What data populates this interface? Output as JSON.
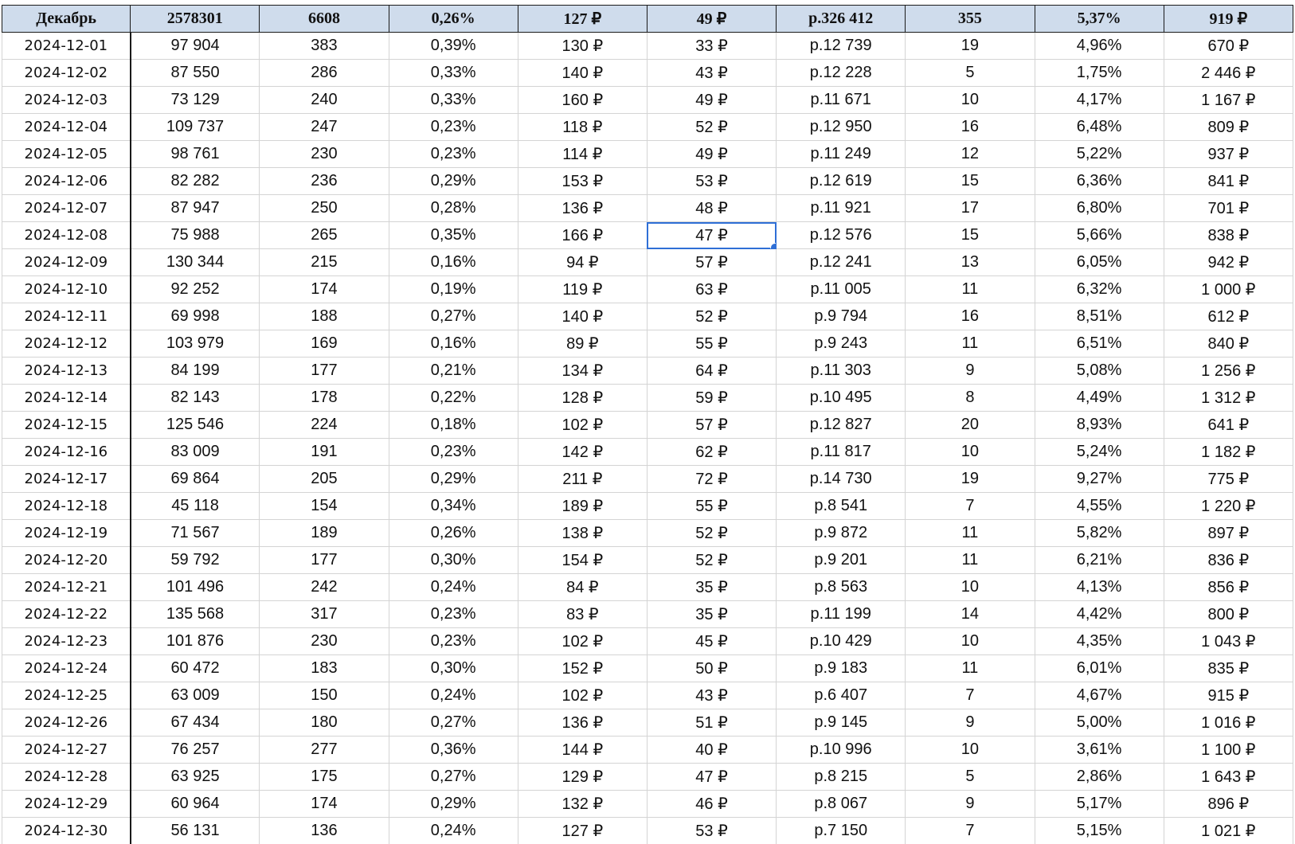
{
  "header": [
    "Декабрь",
    "2578301",
    "6608",
    "0,26%",
    "127 ₽",
    "49 ₽",
    "р.326 412",
    "355",
    "5,37%",
    "919 ₽"
  ],
  "rows": [
    [
      "2024-12-01",
      "97 904",
      "383",
      "0,39%",
      "130 ₽",
      "33 ₽",
      "р.12 739",
      "19",
      "4,96%",
      "670 ₽"
    ],
    [
      "2024-12-02",
      "87 550",
      "286",
      "0,33%",
      "140 ₽",
      "43 ₽",
      "р.12 228",
      "5",
      "1,75%",
      "2 446 ₽"
    ],
    [
      "2024-12-03",
      "73 129",
      "240",
      "0,33%",
      "160 ₽",
      "49 ₽",
      "р.11 671",
      "10",
      "4,17%",
      "1 167 ₽"
    ],
    [
      "2024-12-04",
      "109 737",
      "247",
      "0,23%",
      "118 ₽",
      "52 ₽",
      "р.12 950",
      "16",
      "6,48%",
      "809 ₽"
    ],
    [
      "2024-12-05",
      "98 761",
      "230",
      "0,23%",
      "114 ₽",
      "49 ₽",
      "р.11 249",
      "12",
      "5,22%",
      "937 ₽"
    ],
    [
      "2024-12-06",
      "82 282",
      "236",
      "0,29%",
      "153 ₽",
      "53 ₽",
      "р.12 619",
      "15",
      "6,36%",
      "841 ₽"
    ],
    [
      "2024-12-07",
      "87 947",
      "250",
      "0,28%",
      "136 ₽",
      "48 ₽",
      "р.11 921",
      "17",
      "6,80%",
      "701 ₽"
    ],
    [
      "2024-12-08",
      "75 988",
      "265",
      "0,35%",
      "166 ₽",
      "47 ₽",
      "р.12 576",
      "15",
      "5,66%",
      "838 ₽"
    ],
    [
      "2024-12-09",
      "130 344",
      "215",
      "0,16%",
      "94 ₽",
      "57 ₽",
      "р.12 241",
      "13",
      "6,05%",
      "942 ₽"
    ],
    [
      "2024-12-10",
      "92 252",
      "174",
      "0,19%",
      "119 ₽",
      "63 ₽",
      "р.11 005",
      "11",
      "6,32%",
      "1 000 ₽"
    ],
    [
      "2024-12-11",
      "69 998",
      "188",
      "0,27%",
      "140 ₽",
      "52 ₽",
      "р.9 794",
      "16",
      "8,51%",
      "612 ₽"
    ],
    [
      "2024-12-12",
      "103 979",
      "169",
      "0,16%",
      "89 ₽",
      "55 ₽",
      "р.9 243",
      "11",
      "6,51%",
      "840 ₽"
    ],
    [
      "2024-12-13",
      "84 199",
      "177",
      "0,21%",
      "134 ₽",
      "64 ₽",
      "р.11 303",
      "9",
      "5,08%",
      "1 256 ₽"
    ],
    [
      "2024-12-14",
      "82 143",
      "178",
      "0,22%",
      "128 ₽",
      "59 ₽",
      "р.10 495",
      "8",
      "4,49%",
      "1 312 ₽"
    ],
    [
      "2024-12-15",
      "125 546",
      "224",
      "0,18%",
      "102 ₽",
      "57 ₽",
      "р.12 827",
      "20",
      "8,93%",
      "641 ₽"
    ],
    [
      "2024-12-16",
      "83 009",
      "191",
      "0,23%",
      "142 ₽",
      "62 ₽",
      "р.11 817",
      "10",
      "5,24%",
      "1 182 ₽"
    ],
    [
      "2024-12-17",
      "69 864",
      "205",
      "0,29%",
      "211 ₽",
      "72 ₽",
      "р.14 730",
      "19",
      "9,27%",
      "775 ₽"
    ],
    [
      "2024-12-18",
      "45 118",
      "154",
      "0,34%",
      "189 ₽",
      "55 ₽",
      "р.8 541",
      "7",
      "4,55%",
      "1 220 ₽"
    ],
    [
      "2024-12-19",
      "71 567",
      "189",
      "0,26%",
      "138 ₽",
      "52 ₽",
      "р.9 872",
      "11",
      "5,82%",
      "897 ₽"
    ],
    [
      "2024-12-20",
      "59 792",
      "177",
      "0,30%",
      "154 ₽",
      "52 ₽",
      "р.9 201",
      "11",
      "6,21%",
      "836 ₽"
    ],
    [
      "2024-12-21",
      "101 496",
      "242",
      "0,24%",
      "84 ₽",
      "35 ₽",
      "р.8 563",
      "10",
      "4,13%",
      "856 ₽"
    ],
    [
      "2024-12-22",
      "135 568",
      "317",
      "0,23%",
      "83 ₽",
      "35 ₽",
      "р.11 199",
      "14",
      "4,42%",
      "800 ₽"
    ],
    [
      "2024-12-23",
      "101 876",
      "230",
      "0,23%",
      "102 ₽",
      "45 ₽",
      "р.10 429",
      "10",
      "4,35%",
      "1 043 ₽"
    ],
    [
      "2024-12-24",
      "60 472",
      "183",
      "0,30%",
      "152 ₽",
      "50 ₽",
      "р.9 183",
      "11",
      "6,01%",
      "835 ₽"
    ],
    [
      "2024-12-25",
      "63 009",
      "150",
      "0,24%",
      "102 ₽",
      "43 ₽",
      "р.6 407",
      "7",
      "4,67%",
      "915 ₽"
    ],
    [
      "2024-12-26",
      "67 434",
      "180",
      "0,27%",
      "136 ₽",
      "51 ₽",
      "р.9 145",
      "9",
      "5,00%",
      "1 016 ₽"
    ],
    [
      "2024-12-27",
      "76 257",
      "277",
      "0,36%",
      "144 ₽",
      "40 ₽",
      "р.10 996",
      "10",
      "3,61%",
      "1 100 ₽"
    ],
    [
      "2024-12-28",
      "63 925",
      "175",
      "0,27%",
      "129 ₽",
      "47 ₽",
      "р.8 215",
      "5",
      "2,86%",
      "1 643 ₽"
    ],
    [
      "2024-12-29",
      "60 964",
      "174",
      "0,29%",
      "132 ₽",
      "46 ₽",
      "р.8 067",
      "9",
      "5,17%",
      "896 ₽"
    ],
    [
      "2024-12-30",
      "56 131",
      "136",
      "0,24%",
      "127 ₽",
      "53 ₽",
      "р.7 150",
      "7",
      "5,15%",
      "1 021 ₽"
    ]
  ],
  "selection": {
    "row": 7,
    "col": 5
  },
  "colors": {
    "header_bg": "#cfdcec",
    "selection": "#2f6fd6",
    "gridline": "#d4d4d4"
  }
}
